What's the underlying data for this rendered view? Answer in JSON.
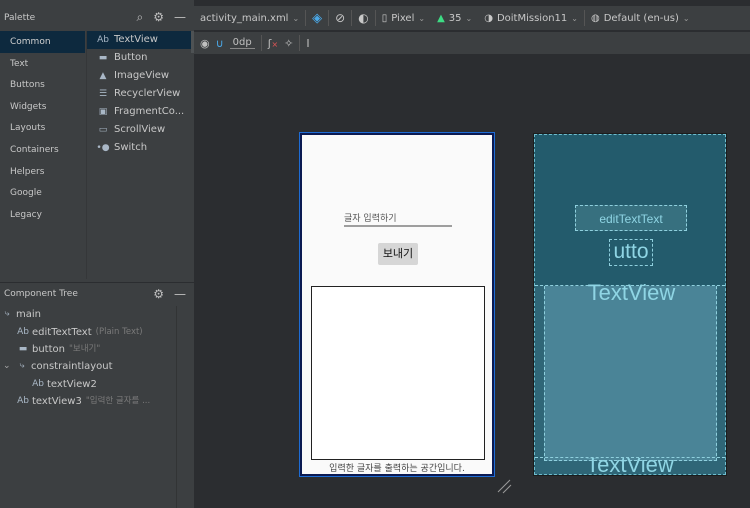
{
  "palette": {
    "title": "Palette",
    "categories": [
      "Common",
      "Text",
      "Buttons",
      "Widgets",
      "Layouts",
      "Containers",
      "Helpers",
      "Google",
      "Legacy"
    ],
    "selected_category": "Common",
    "widgets": [
      {
        "icon": "Ab",
        "label": "TextView"
      },
      {
        "icon": "▬",
        "label": "Button"
      },
      {
        "icon": "▲",
        "label": "ImageView"
      },
      {
        "icon": "☰",
        "label": "RecyclerView"
      },
      {
        "icon": "▣",
        "label": "FragmentCo..."
      },
      {
        "icon": "▭",
        "label": "ScrollView"
      },
      {
        "icon": "•●",
        "label": "Switch"
      }
    ]
  },
  "component_tree": {
    "title": "Component Tree",
    "nodes": [
      {
        "icon": "⤷",
        "label": "main",
        "hint": ""
      },
      {
        "icon": "Ab",
        "label": "editTextText",
        "hint": "(Plain Text)"
      },
      {
        "icon": "▬",
        "label": "button",
        "hint": "\"보내기\""
      },
      {
        "icon": "⤷",
        "label": "constraintlayout",
        "hint": ""
      },
      {
        "icon": "Ab",
        "label": "textView2",
        "hint": ""
      },
      {
        "icon": "Ab",
        "label": "textView3",
        "hint": "\"입력한 글자를 ..."
      }
    ]
  },
  "toolbar": {
    "file": "activity_main.xml",
    "device": "Pixel",
    "api": "35",
    "theme": "DoitMission11",
    "locale": "Default (en-us)",
    "margin": "0dp"
  },
  "design": {
    "edit_hint": "글자 입력하기",
    "button_label": "보내기",
    "footer_text": "입력한 글자를 출력하는 공간입니다."
  },
  "blueprint": {
    "edit_label": "editTextText",
    "button_label": "utto",
    "textview_label": "TextView",
    "textview3_label": "TextView"
  },
  "colors": {
    "selection": "#0d293e",
    "blueprint_bg": "#235b6c",
    "blueprint_text": "#8fd5e4"
  }
}
